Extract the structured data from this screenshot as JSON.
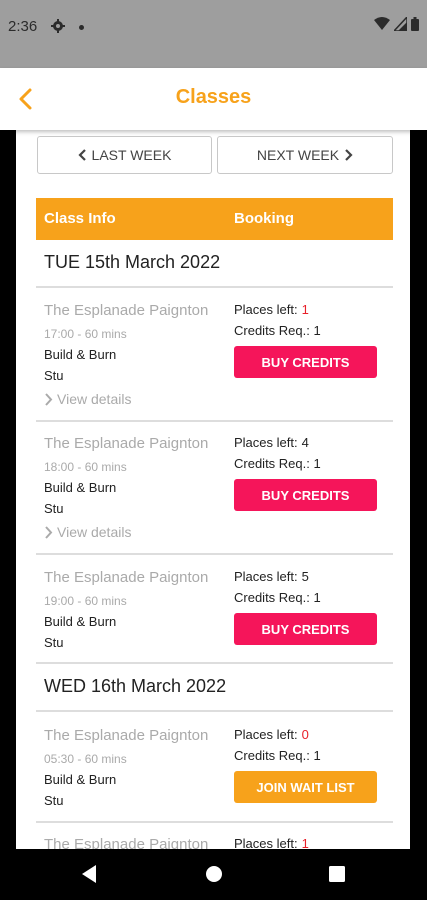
{
  "status_bar": {
    "time": "2:36"
  },
  "app_bar": {
    "title": "Classes"
  },
  "week_nav": {
    "last": "LAST WEEK",
    "next": "NEXT WEEK"
  },
  "table_header": {
    "class_info": "Class Info",
    "booking": "Booking"
  },
  "days": [
    {
      "label": "TUE 15th March 2022"
    },
    {
      "label": "WED 16th March 2022"
    }
  ],
  "classes": [
    {
      "location": "The Esplanade Paignton",
      "time": "17:00 - 60 mins",
      "name": "Build & Burn",
      "instructor": "Stu",
      "details": "View details",
      "places_label": "Places left:",
      "places": "1",
      "places_color": "#e8202a",
      "credits": "Credits Req.: 1",
      "action": "BUY CREDITS"
    },
    {
      "location": "The Esplanade Paignton",
      "time": "18:00 - 60 mins",
      "name": "Build & Burn",
      "instructor": "Stu",
      "details": "View details",
      "places_label": "Places left:",
      "places": "4",
      "places_color": "#222222",
      "credits": "Credits Req.: 1",
      "action": "BUY CREDITS"
    },
    {
      "location": "The Esplanade Paignton",
      "time": "19:00 - 60 mins",
      "name": "Build & Burn",
      "instructor": "Stu",
      "places_label": "Places left:",
      "places": "5",
      "places_color": "#222222",
      "credits": "Credits Req.: 1",
      "action": "BUY CREDITS"
    },
    {
      "location": "The Esplanade Paignton",
      "time": "05:30 - 60 mins",
      "name": "Build & Burn",
      "instructor": "Stu",
      "places_label": "Places left:",
      "places": "0",
      "places_color": "#e8202a",
      "credits": "Credits Req.: 1",
      "action": "JOIN WAIT LIST"
    },
    {
      "location": "The Esplanade Paignton",
      "places_label": "Places left:",
      "places": "1",
      "places_color": "#e8202a"
    }
  ],
  "colors": {
    "accent": "#f7a21b",
    "buy": "#f5155a",
    "alert": "#e8202a"
  }
}
